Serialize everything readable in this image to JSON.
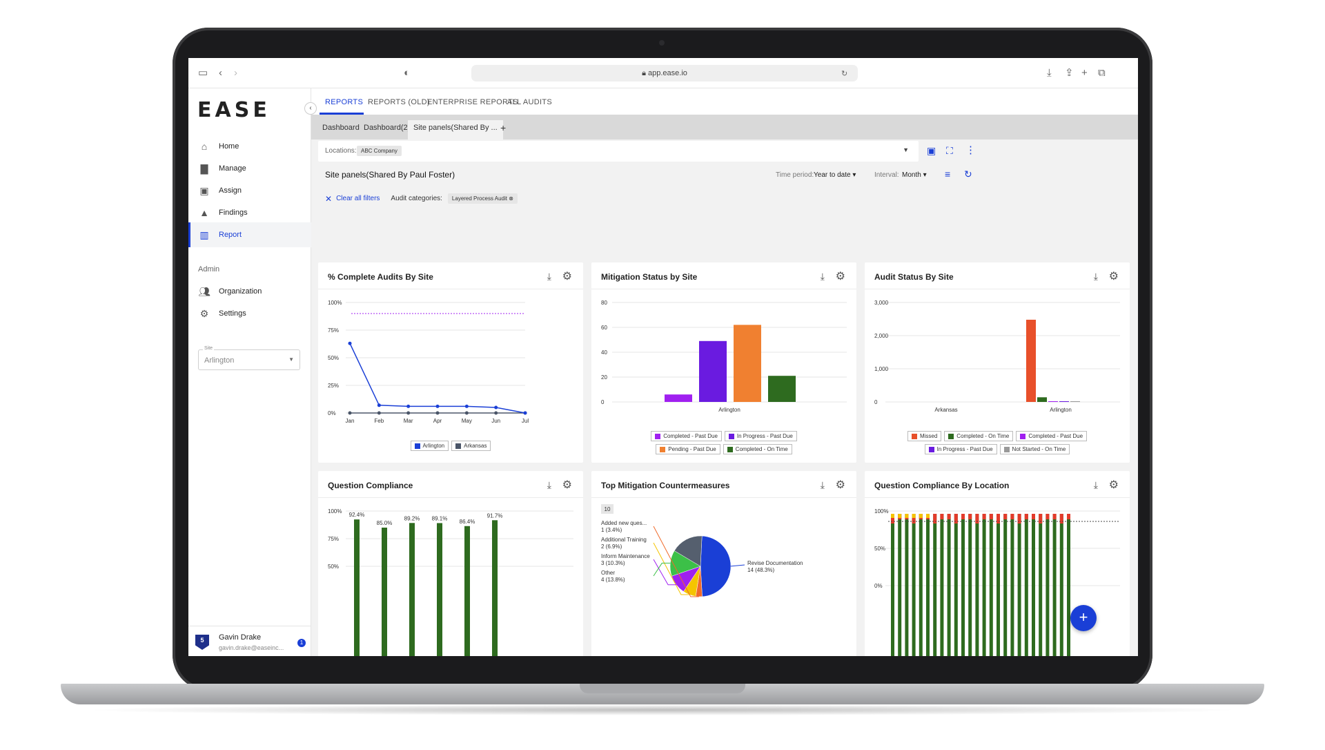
{
  "browser": {
    "url": "app.ease.io"
  },
  "app": {
    "logo": "EASE"
  },
  "sidebar": {
    "items": [
      {
        "label": "Home",
        "icon": "home-icon"
      },
      {
        "label": "Manage",
        "icon": "briefcase-icon"
      },
      {
        "label": "Assign",
        "icon": "calendar-icon"
      },
      {
        "label": "Findings",
        "icon": "warning-icon"
      },
      {
        "label": "Report",
        "icon": "bar-chart-icon",
        "active": true
      }
    ],
    "admin_label": "Admin",
    "admin_items": [
      {
        "label": "Organization",
        "icon": "people-icon"
      },
      {
        "label": "Settings",
        "icon": "gear-icon"
      }
    ],
    "site_select": {
      "label": "Site",
      "value": "Arlington"
    },
    "user": {
      "badge": "5",
      "name": "Gavin Drake",
      "email": "gavin.drake@easeinc...",
      "notifications": "1"
    }
  },
  "topnav": {
    "tabs": [
      "REPORTS",
      "REPORTS (OLD)",
      "ENTERPRISE REPORTS",
      "ALL AUDITS"
    ]
  },
  "subtabs": {
    "tabs": [
      "Dashboard",
      "Dashboard(2)",
      "Site panels(Shared By ..."
    ],
    "add": "+"
  },
  "locations": {
    "label": "Locations:",
    "chip": "ABC Company"
  },
  "report": {
    "title": "Site panels(Shared By Paul Foster)",
    "time_period_label": "Time period:",
    "time_period_value": "Year to date",
    "interval_label": "Interval:",
    "interval_value": "Month",
    "clear_filters": "Clear all filters",
    "audit_categories_label": "Audit categories:",
    "audit_category_chip": "Layered Process Audit"
  },
  "panels": {
    "p1": {
      "title": "% Complete Audits By Site"
    },
    "p2": {
      "title": "Mitigation Status by Site"
    },
    "p3": {
      "title": "Audit Status By Site"
    },
    "p4": {
      "title": "Question Compliance"
    },
    "p5": {
      "title": "Top Mitigation Countermeasures"
    },
    "p6": {
      "title": "Question Compliance By Location"
    }
  },
  "chart_data": [
    {
      "type": "line",
      "title": "% Complete Audits By Site",
      "categories": [
        "Jan",
        "Feb",
        "Mar",
        "Apr",
        "May",
        "Jun",
        "Jul"
      ],
      "y_ticks": [
        "100%",
        "75%",
        "50%",
        "25%",
        "0%"
      ],
      "ylim": [
        0,
        100
      ],
      "target_line": 90,
      "series": [
        {
          "name": "Arlington",
          "color": "#1a3fd6",
          "values": [
            63,
            7,
            6,
            6,
            6,
            5,
            0
          ]
        },
        {
          "name": "Arkansas",
          "color": "#4a5568",
          "values": [
            0,
            0,
            0,
            0,
            0,
            0,
            0
          ]
        }
      ]
    },
    {
      "type": "bar",
      "title": "Mitigation Status by Site",
      "categories": [
        "Arlington"
      ],
      "y_ticks": [
        "80",
        "60",
        "40",
        "20",
        "0"
      ],
      "ylim": [
        0,
        80
      ],
      "series": [
        {
          "name": "Completed - Past Due",
          "color": "#a020f0",
          "values": [
            6
          ]
        },
        {
          "name": "In Progress - Past Due",
          "color": "#6a1be0",
          "values": [
            49
          ]
        },
        {
          "name": "Pending - Past Due",
          "color": "#f08030",
          "values": [
            62
          ]
        },
        {
          "name": "Completed - On Time",
          "color": "#2e6b1f",
          "values": [
            21
          ]
        }
      ]
    },
    {
      "type": "bar",
      "title": "Audit Status By Site",
      "categories": [
        "Arkansas",
        "Arlington"
      ],
      "y_ticks": [
        "3,000",
        "2,000",
        "1,000",
        "0"
      ],
      "ylim": [
        0,
        3000
      ],
      "series": [
        {
          "name": "Missed",
          "color": "#e8502a",
          "values": [
            0,
            2480
          ]
        },
        {
          "name": "Completed - On Time",
          "color": "#2e6b1f",
          "values": [
            0,
            140
          ]
        },
        {
          "name": "Completed - Past Due",
          "color": "#a020f0",
          "values": [
            0,
            10
          ]
        },
        {
          "name": "In Progress - Past Due",
          "color": "#6a1be0",
          "values": [
            0,
            10
          ]
        },
        {
          "name": "Not Started - On Time",
          "color": "#999999",
          "values": [
            0,
            5
          ]
        }
      ]
    },
    {
      "type": "bar",
      "title": "Question Compliance",
      "y_ticks": [
        "100%",
        "75%",
        "50%"
      ],
      "ylim": [
        0,
        100
      ],
      "values": [
        92.4,
        85.0,
        89.2,
        89.1,
        86.4,
        91.7
      ],
      "labels": [
        "92.4%",
        "85.0%",
        "89.2%",
        "89.1%",
        "86.4%",
        "91.7%"
      ],
      "color": "#2e6b1f"
    },
    {
      "type": "pie",
      "title": "Top Mitigation Countermeasures",
      "top_n": "10",
      "slices": [
        {
          "label": "Revise Documentation",
          "value": 14,
          "pct": "14 (48.3%)",
          "color": "#1a3fd6"
        },
        {
          "label": "Added new ques...",
          "value": 1,
          "pct": "1 (3.4%)",
          "color": "#f06a2a"
        },
        {
          "label": "Additional Training",
          "value": 2,
          "pct": "2 (6.9%)",
          "color": "#f5c400"
        },
        {
          "label": "Inform Maintenance",
          "value": 3,
          "pct": "3 (10.3%)",
          "color": "#a020f0"
        },
        {
          "label": "Other",
          "value": 4,
          "pct": "4 (13.8%)",
          "color": "#3cc048"
        },
        {
          "label": "",
          "value": 5,
          "pct": "",
          "color": "#555f6e"
        }
      ]
    },
    {
      "type": "bar",
      "title": "Question Compliance By Location",
      "y_ticks": [
        "100%",
        "50%",
        "0%"
      ],
      "ylim": [
        0,
        100
      ],
      "bar_count": 26
    }
  ],
  "legend_p1": [
    "Arlington",
    "Arkansas"
  ],
  "legend_p2": [
    "Completed - Past Due",
    "In Progress - Past Due",
    "Pending - Past Due",
    "Completed - On Time"
  ],
  "legend_p3": [
    "Missed",
    "Completed - On Time",
    "Completed - Past Due",
    "In Progress - Past Due",
    "Not Started - On Time"
  ]
}
